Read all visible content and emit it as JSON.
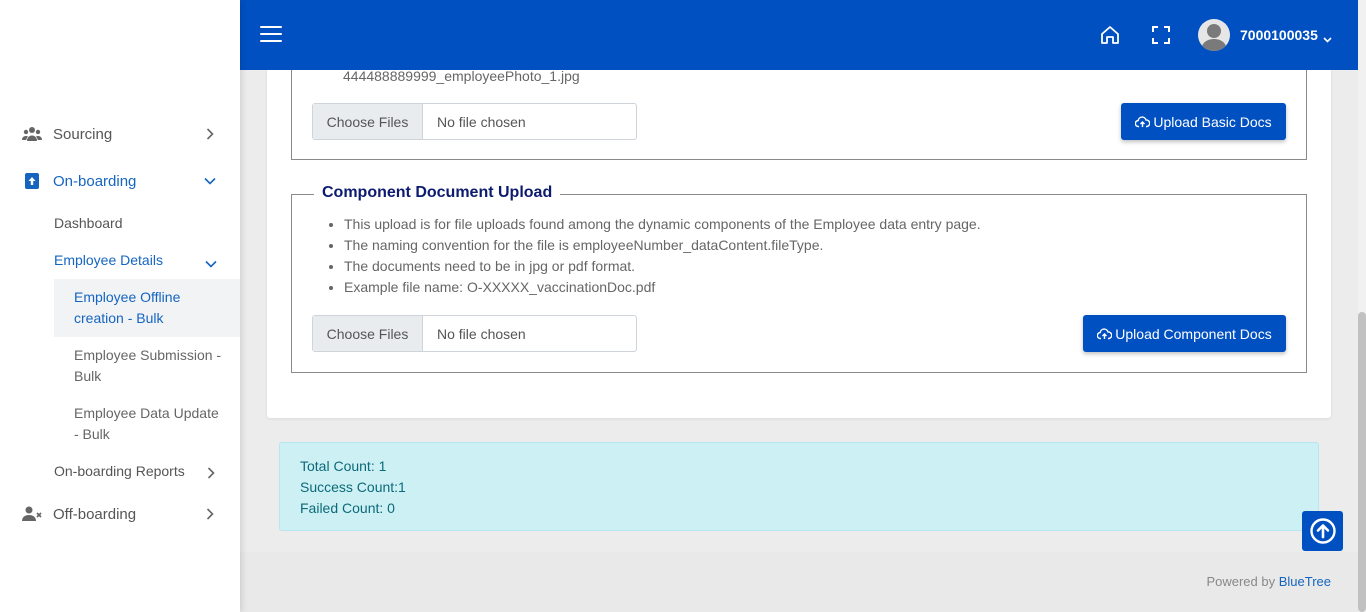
{
  "sidebar": {
    "sourcing": "Sourcing",
    "onboarding": "On-boarding",
    "dashboard": "Dashboard",
    "employee_details": "Employee Details",
    "offline_creation_line1": "Employee Offline",
    "offline_creation_line2": "creation - Bulk",
    "submission_line1": "Employee Submission -",
    "submission_line2": "Bulk",
    "data_update_line1": "Employee Data Update",
    "data_update_line2": "- Bulk",
    "onboarding_reports": "On-boarding Reports",
    "offboarding": "Off-boarding"
  },
  "header": {
    "user_id": "7000100035"
  },
  "basic_docs": {
    "example_filename": "444488889999_employeePhoto_1.jpg",
    "choose_label": "Choose Files",
    "no_file": "No file chosen",
    "upload_label": "Upload Basic Docs"
  },
  "component_docs": {
    "legend": "Component Document Upload",
    "bullets": [
      "This upload is for file uploads found among the dynamic components of the Employee data entry page.",
      "The naming convention for the file is employeeNumber_dataContent.fileType.",
      "The documents need to be in jpg or pdf format.",
      "Example file name: O-XXXXX_vaccinationDoc.pdf"
    ],
    "choose_label": "Choose Files",
    "no_file": "No file chosen",
    "upload_label": "Upload Component Docs"
  },
  "results": {
    "total": "Total Count: 1",
    "success": "Success Count:1",
    "failed": "Failed Count: 0"
  },
  "footer": {
    "powered_by": "Powered by",
    "brand": "BlueTree"
  },
  "colors": {
    "primary": "#0050c2",
    "active_link": "#1565c0",
    "legend": "#0d1b6e",
    "alert_bg": "#cdf0f4",
    "alert_text": "#0c6a78"
  }
}
